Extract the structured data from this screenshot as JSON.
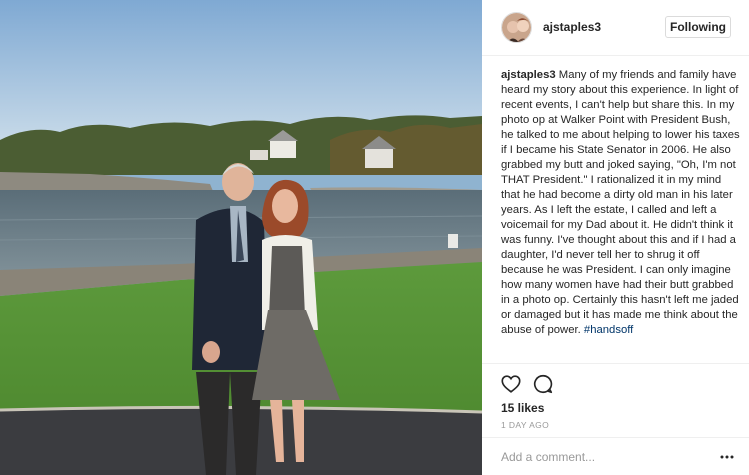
{
  "post": {
    "username": "ajstaples3",
    "follow_label": "Following",
    "caption": {
      "username": "ajstaples3",
      "text": " Many of my friends and family have heard my story about this experience. In light of recent events, I can't help but share this. In my photo op at Walker Point with President Bush, he talked to me about helping to lower his taxes if I became his State Senator in 2006. He also grabbed my butt and joked saying, \"Oh, I'm not THAT President.\" I rationalized it in my mind that he had become a dirty old man in his later years. As I left the estate, I called and left a voicemail for my Dad about it. He didn't think it was funny. I've thought about this and if I had a daughter, I'd never tell her to shrug it off because he was President. I can only imagine how many women have had their butt grabbed in a photo op. Certainly this hasn't left me jaded or damaged but it has made me think about the abuse of power. ",
      "hashtag": "#handsoff"
    },
    "likes": "15 likes",
    "time": "1 DAY AGO",
    "comment_placeholder": "Add a comment...",
    "icons": {
      "like": "heart-icon",
      "comment": "comment-bubble-icon",
      "more": "more-options-icon"
    }
  },
  "colors": {
    "text": "#262626",
    "muted": "#999999",
    "hashtag": "#003569",
    "border": "#efefef"
  }
}
